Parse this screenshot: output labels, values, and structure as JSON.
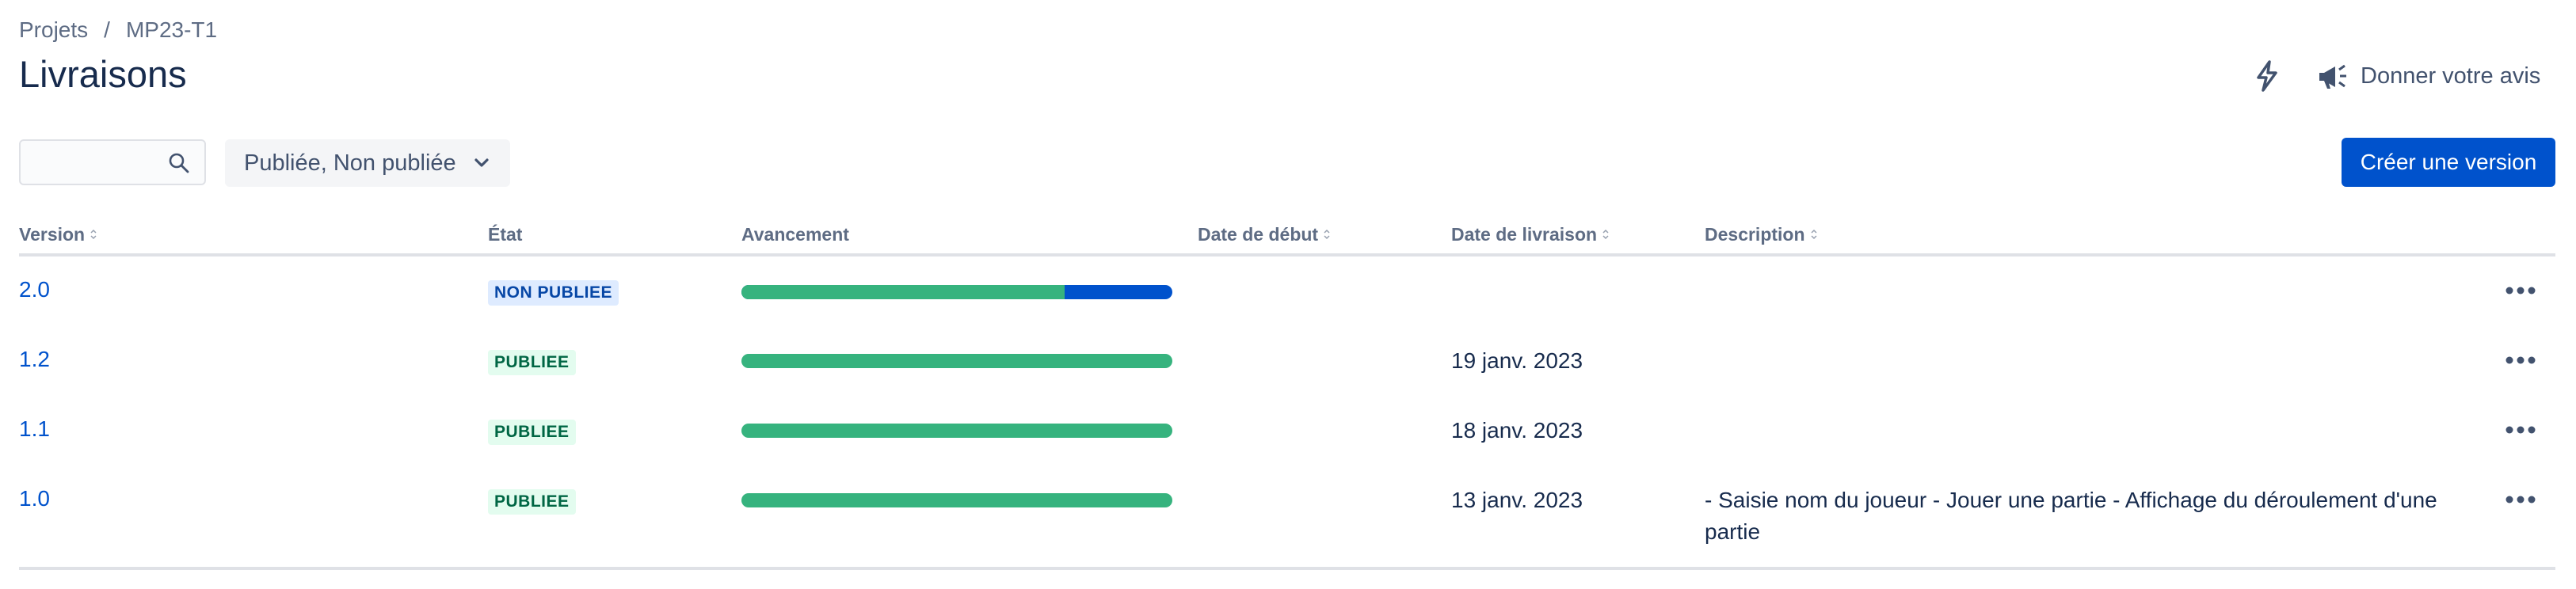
{
  "breadcrumb": {
    "projects": "Projets",
    "separator": "/",
    "project": "MP23-T1"
  },
  "page": {
    "title": "Livraisons"
  },
  "header_actions": {
    "bolt_icon": "lightning-bolt-icon",
    "feedback_label": "Donner votre avis",
    "feedback_icon": "megaphone-icon"
  },
  "toolbar": {
    "search_placeholder": "",
    "search_icon": "search-icon",
    "filter_label": "Publiée, Non publiée",
    "create_label": "Créer une version"
  },
  "table": {
    "columns": [
      "Version",
      "État",
      "Avancement",
      "Date de début",
      "Date de livraison",
      "Description"
    ],
    "rows": [
      {
        "version": "2.0",
        "status": "NON PUBLIEE",
        "status_kind": "unreleased",
        "progress_done": 0.75,
        "start_date": "",
        "release_date": "",
        "description": ""
      },
      {
        "version": "1.2",
        "status": "PUBLIEE",
        "status_kind": "released",
        "progress_done": 1.0,
        "start_date": "",
        "release_date": "19 janv. 2023",
        "description": ""
      },
      {
        "version": "1.1",
        "status": "PUBLIEE",
        "status_kind": "released",
        "progress_done": 1.0,
        "start_date": "",
        "release_date": "18 janv. 2023",
        "description": ""
      },
      {
        "version": "1.0",
        "status": "PUBLIEE",
        "status_kind": "released",
        "progress_done": 1.0,
        "start_date": "",
        "release_date": "13 janv. 2023",
        "description": "- Saisie nom du joueur - Jouer une partie - Affichage du déroulement d'une partie"
      }
    ]
  },
  "colors": {
    "accent": "#0052cc",
    "progress_done": "#36b37e",
    "text": "#172b4d",
    "muted": "#5e6c84"
  }
}
